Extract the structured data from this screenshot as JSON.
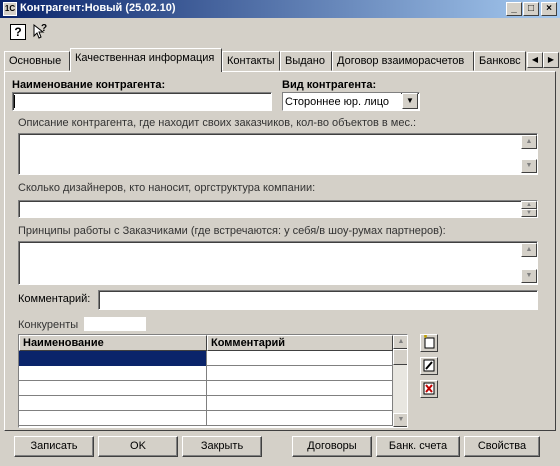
{
  "window": {
    "title": "Контрагент:Новый (25.02.10)",
    "controls": [
      "_",
      "□",
      "×"
    ]
  },
  "toolbar": {
    "help_glyph": "?",
    "context_help_glyph": "?"
  },
  "tabs": [
    {
      "label": "Основные"
    },
    {
      "label": "Качественная информация"
    },
    {
      "label": "Контакты"
    },
    {
      "label": "Выдано"
    },
    {
      "label": "Договор взаиморасчетов"
    },
    {
      "label": "Банковс"
    }
  ],
  "active_tab": "Качественная информация",
  "form": {
    "name_label": "Наименование контрагента:",
    "name_value": "",
    "type_label": "Вид контрагента:",
    "type_value": "Стороннее юр. лицо",
    "description_label": "Описание контрагента, где находит своих заказчиков, кол-во объектов в мес.:",
    "description_value": "",
    "designers_label": "Сколько дизайнеров, кто наносит, оргструктура компании:",
    "designers_value": "",
    "principles_label": "Принципы работы с Заказчиками (где встречаются: у себя/в шоу-румах партнеров):",
    "principles_value": "",
    "comment_label": "Комментарий:",
    "comment_value": "",
    "competitors_label": "Конкуренты"
  },
  "competitors_table": {
    "columns": [
      "Наименование",
      "Комментарий"
    ],
    "rows": [
      [
        "",
        ""
      ],
      [
        "",
        ""
      ],
      [
        "",
        ""
      ],
      [
        "",
        ""
      ],
      [
        "",
        ""
      ]
    ]
  },
  "buttons": {
    "save": "Записать",
    "ok": "OK",
    "close": "Закрыть",
    "contracts": "Договоры",
    "bank_accounts": "Банк. счета",
    "properties": "Свойства"
  },
  "colors": {
    "title_bar": "#0a246a",
    "selection": "#0a246a",
    "face": "#d4d0c8"
  }
}
